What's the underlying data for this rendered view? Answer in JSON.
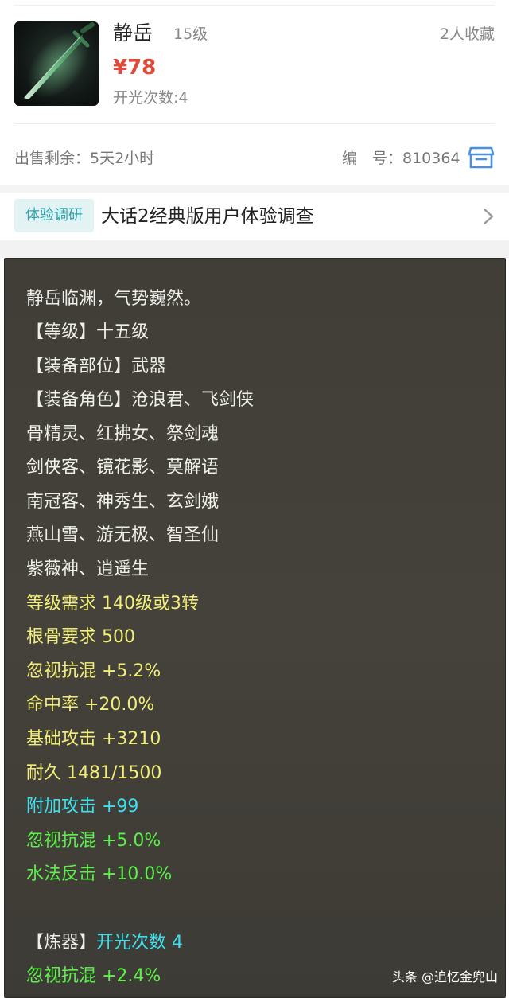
{
  "item": {
    "name": "静岳",
    "level": "15级",
    "favorites": "2人收藏",
    "price": "¥78",
    "open_count": "开光次数:4",
    "image_icon": "sword-icon"
  },
  "sale": {
    "remaining": "出售剩余：5天2小时",
    "serial": "编　号：810364",
    "cart_icon": "cart-icon"
  },
  "survey": {
    "badge": "体验调研",
    "title": "大话2经典版用户体验调查",
    "chevron_icon": "chevron-right-icon"
  },
  "tooltip": {
    "lines": [
      "静岳临渊，气势巍然。",
      "【等级】十五级",
      "【装备部位】武器",
      "【装备角色】沧浪君、飞剑侠",
      "骨精灵、红拂女、祭剑魂",
      "剑侠客、镜花影、莫解语",
      "南冠客、神秀生、玄剑娥",
      "燕山雪、游无极、智圣仙",
      "紫薇神、逍遥生",
      "等级需求 140级或3转",
      "根骨要求 500",
      "忽视抗混 +5.2%",
      "命中率 +20.0%",
      "基础攻击 +3210",
      "耐久 1481/1500",
      "附加攻击 +99",
      "忽视抗混 +5.0%",
      "水法反击 +10.0%",
      "【炼器】",
      "开光次数 4",
      "忽视抗混 +2.4%"
    ]
  },
  "watermark": "头条 @追忆金兜山",
  "colors": {
    "price": "#e04a3a",
    "survey_badge": "#2fa4ae",
    "tooltip_bg": "#403e37",
    "text_white": "#f0f0ea",
    "text_yellow": "#f2ee7a",
    "text_cyan": "#3ee0ee",
    "text_green": "#5cf04a"
  }
}
